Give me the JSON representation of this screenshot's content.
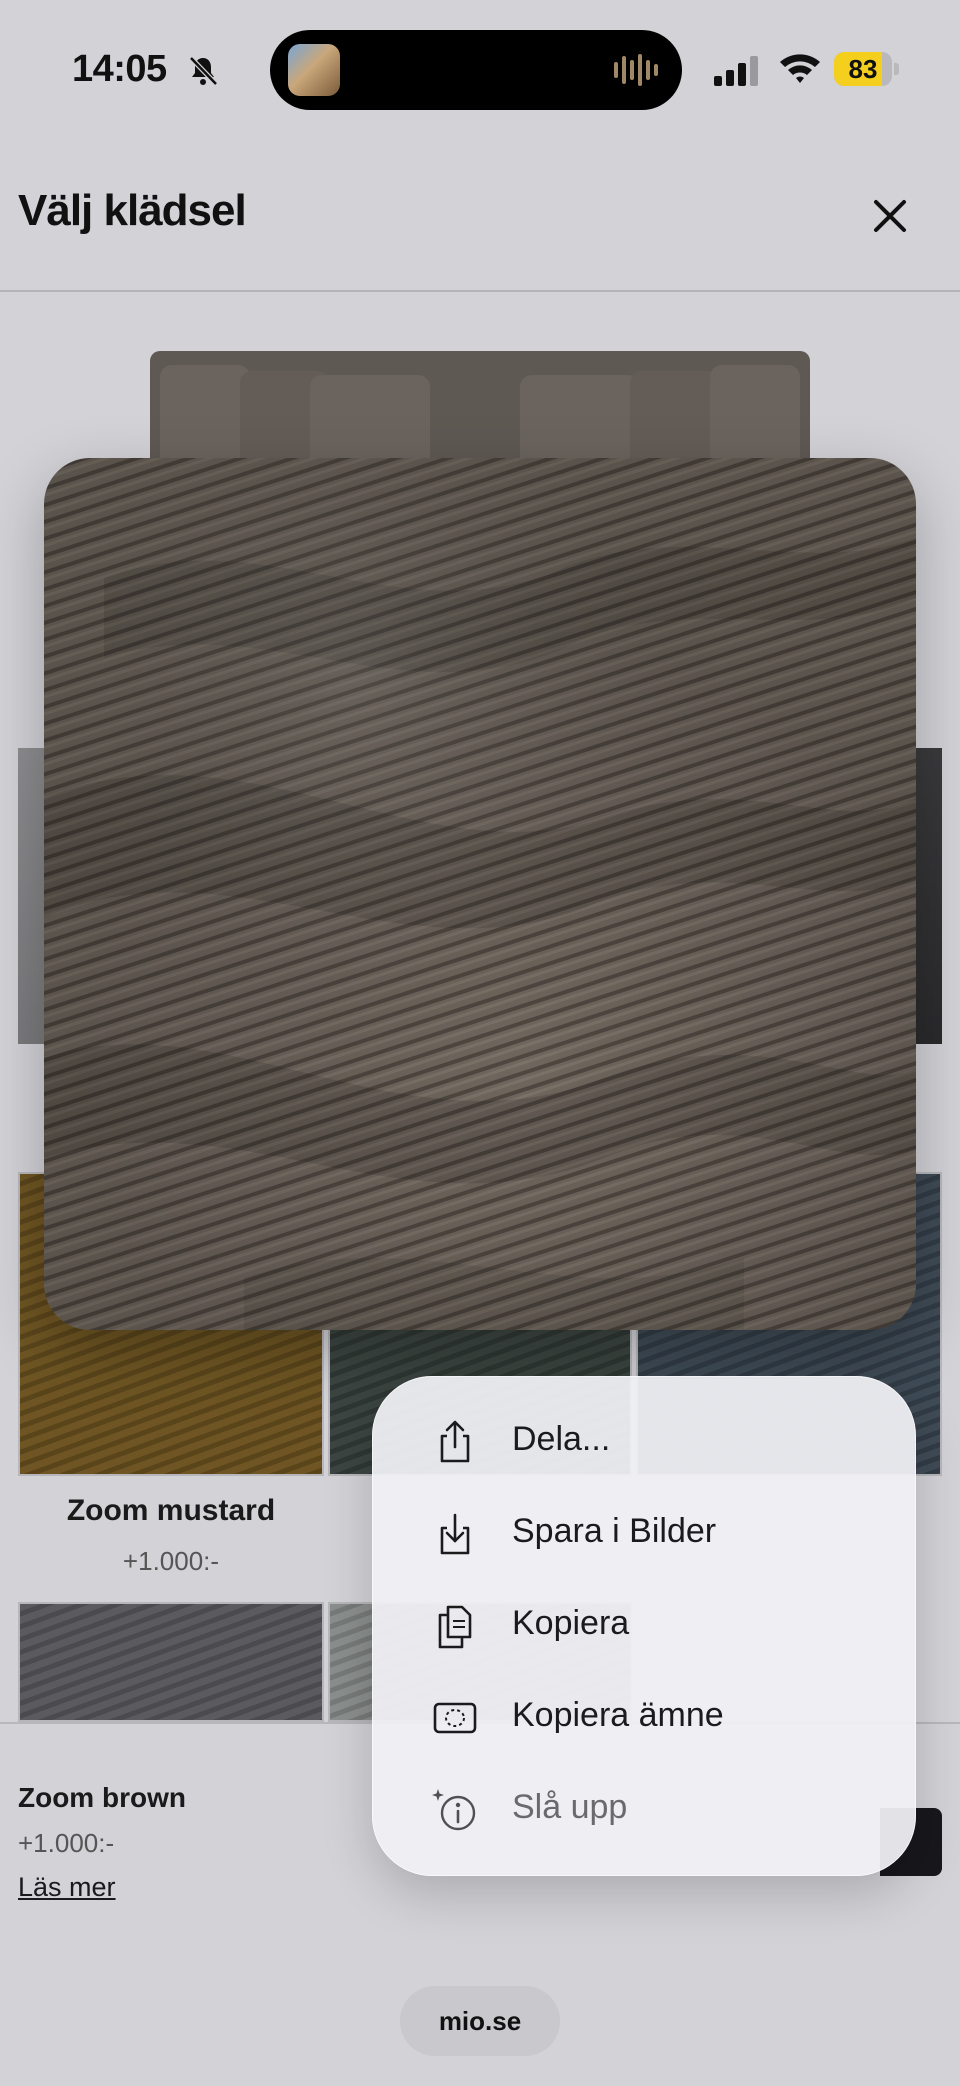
{
  "status_bar": {
    "time": "14:05",
    "battery_percent": "83",
    "battery_level": 0.83
  },
  "header": {
    "title": "Välj klädsel"
  },
  "grid": {
    "items": [
      {
        "name": "Zoom mustard",
        "price": "+1.000:-"
      }
    ]
  },
  "selection": {
    "name": "Zoom brown",
    "price": "+1.000:-",
    "link": "Läs mer"
  },
  "context_menu": {
    "items": [
      {
        "label": "Dela...",
        "icon": "share-icon"
      },
      {
        "label": "Spara i Bilder",
        "icon": "save-to-photos-icon"
      },
      {
        "label": "Kopiera",
        "icon": "copy-icon"
      },
      {
        "label": "Kopiera ämne",
        "icon": "copy-subject-icon"
      },
      {
        "label": "Slå upp",
        "icon": "look-up-icon"
      }
    ]
  },
  "browser": {
    "url": "mio.se"
  },
  "colors": {
    "fabric": "#6e655d",
    "menu_bg": "#f0f0f4",
    "battery": "#f5cf1e"
  }
}
